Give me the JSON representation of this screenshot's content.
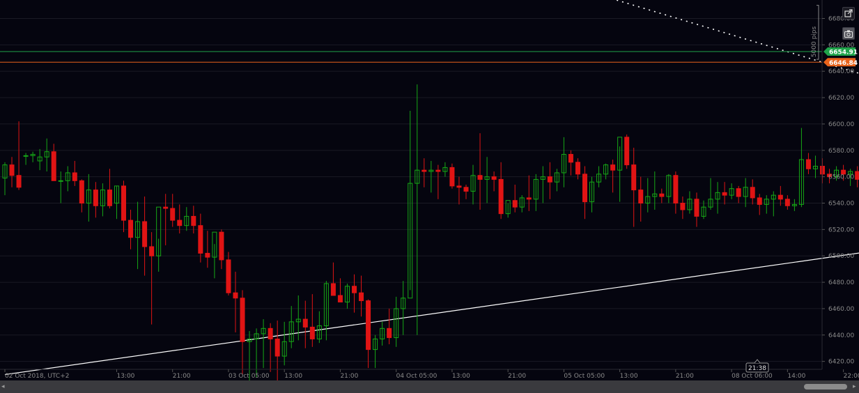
{
  "chart_data": {
    "type": "candlestick",
    "ylim": [
      6414,
      6694
    ],
    "y_ticks": [
      6420,
      6440,
      6460,
      6480,
      6500,
      6520,
      6540,
      6560,
      6580,
      6600,
      6620,
      6640,
      6660,
      6680
    ],
    "y_tick_labels": [
      "6420.00",
      "6440.00",
      "6460.00",
      "6480.00",
      "6500.00",
      "6520.00",
      "6540.00",
      "6560.00",
      "6580.00",
      "6600.00",
      "6620.00",
      "6640.00",
      "6660.00",
      "6680.00"
    ],
    "x_tick_labels": [
      {
        "label": "02 Oct 2018, UTC+2",
        "bar": 0
      },
      {
        "label": "13:00",
        "bar": 16
      },
      {
        "label": "21:00",
        "bar": 24
      },
      {
        "label": "03 Oct 05:00",
        "bar": 32
      },
      {
        "label": "13:00",
        "bar": 40
      },
      {
        "label": "21:00",
        "bar": 48
      },
      {
        "label": "04 Oct 05:00",
        "bar": 56
      },
      {
        "label": "13:00",
        "bar": 64
      },
      {
        "label": "21:00",
        "bar": 72
      },
      {
        "label": "05 Oct 05:00",
        "bar": 80
      },
      {
        "label": "13:00",
        "bar": 88
      },
      {
        "label": "21:00",
        "bar": 96
      },
      {
        "label": "08 Oct 06:00",
        "bar": 104
      },
      {
        "label": "14:00",
        "bar": 112
      },
      {
        "label": "22:00",
        "bar": 120
      }
    ],
    "candles": [
      [
        6559,
        6571,
        6546,
        6569
      ],
      [
        6569,
        6575,
        6552,
        6561
      ],
      [
        6561,
        6602,
        6550,
        6552
      ],
      [
        6576,
        6578,
        6569,
        6576
      ],
      [
        6576,
        6579,
        6571,
        6577
      ],
      [
        6572,
        6581,
        6565,
        6575
      ],
      [
        6575,
        6589,
        6564,
        6579
      ],
      [
        6579,
        6585,
        6560,
        6557
      ],
      [
        6557,
        6564,
        6540,
        6557
      ],
      [
        6557,
        6568,
        6549,
        6563
      ],
      [
        6563,
        6572,
        6553,
        6557
      ],
      [
        6557,
        6558,
        6533,
        6540
      ],
      [
        6540,
        6562,
        6526,
        6550
      ],
      [
        6550,
        6556,
        6529,
        6538
      ],
      [
        6538,
        6555,
        6530,
        6550
      ],
      [
        6550,
        6566,
        6536,
        6538
      ],
      [
        6540,
        6553,
        6528,
        6553
      ],
      [
        6553,
        6557,
        6518,
        6527
      ],
      [
        6527,
        6535,
        6505,
        6514
      ],
      [
        6514,
        6541,
        6490,
        6526
      ],
      [
        6526,
        6545,
        6485,
        6507
      ],
      [
        6507,
        6518,
        6448,
        6500
      ],
      [
        6500,
        6513,
        6488,
        6537
      ],
      [
        6537,
        6547,
        6508,
        6536
      ],
      [
        6536,
        6547,
        6522,
        6527
      ],
      [
        6527,
        6539,
        6517,
        6523
      ],
      [
        6523,
        6537,
        6519,
        6530
      ],
      [
        6530,
        6538,
        6517,
        6523
      ],
      [
        6523,
        6532,
        6495,
        6502
      ],
      [
        6502,
        6519,
        6491,
        6499
      ],
      [
        6499,
        6509,
        6483,
        6518
      ],
      [
        6518,
        6520,
        6490,
        6497
      ],
      [
        6497,
        6503,
        6470,
        6472
      ],
      [
        6472,
        6488,
        6442,
        6468
      ],
      [
        6468,
        6474,
        6410,
        6435
      ],
      [
        6435,
        6443,
        6405,
        6437
      ],
      [
        6437,
        6445,
        6408,
        6441
      ],
      [
        6441,
        6452,
        6415,
        6445
      ],
      [
        6445,
        6449,
        6412,
        6437
      ],
      [
        6437,
        6451,
        6405,
        6424
      ],
      [
        6424,
        6450,
        6417,
        6435
      ],
      [
        6435,
        6462,
        6430,
        6450
      ],
      [
        6450,
        6470,
        6436,
        6452
      ],
      [
        6452,
        6466,
        6430,
        6446
      ],
      [
        6446,
        6471,
        6431,
        6437
      ],
      [
        6437,
        6458,
        6434,
        6447
      ],
      [
        6447,
        6481,
        6436,
        6479
      ],
      [
        6479,
        6495,
        6477,
        6470
      ],
      [
        6470,
        6483,
        6465,
        6465
      ],
      [
        6465,
        6479,
        6460,
        6477
      ],
      [
        6477,
        6486,
        6457,
        6472
      ],
      [
        6472,
        6485,
        6454,
        6466
      ],
      [
        6466,
        6467,
        6415,
        6429
      ],
      [
        6429,
        6440,
        6415,
        6437
      ],
      [
        6437,
        6450,
        6432,
        6445
      ],
      [
        6445,
        6460,
        6433,
        6438
      ],
      [
        6438,
        6469,
        6431,
        6460
      ],
      [
        6460,
        6481,
        6440,
        6468
      ],
      [
        6468,
        6610,
        6474,
        6555
      ],
      [
        6555,
        6630,
        6440,
        6565
      ],
      [
        6565,
        6574,
        6552,
        6564
      ],
      [
        6564,
        6572,
        6548,
        6565
      ],
      [
        6565,
        6569,
        6543,
        6564
      ],
      [
        6564,
        6571,
        6560,
        6567
      ],
      [
        6567,
        6570,
        6551,
        6553
      ],
      [
        6553,
        6560,
        6539,
        6552
      ],
      [
        6552,
        6554,
        6543,
        6549
      ],
      [
        6549,
        6569,
        6539,
        6561
      ],
      [
        6561,
        6593,
        6535,
        6558
      ],
      [
        6558,
        6575,
        6540,
        6560
      ],
      [
        6560,
        6564,
        6549,
        6558
      ],
      [
        6558,
        6571,
        6528,
        6532
      ],
      [
        6532,
        6540,
        6529,
        6542
      ],
      [
        6542,
        6554,
        6533,
        6537
      ],
      [
        6537,
        6546,
        6533,
        6544
      ],
      [
        6544,
        6561,
        6534,
        6543
      ],
      [
        6543,
        6562,
        6534,
        6558
      ],
      [
        6558,
        6568,
        6540,
        6560
      ],
      [
        6560,
        6571,
        6543,
        6556
      ],
      [
        6556,
        6566,
        6549,
        6563
      ],
      [
        6563,
        6590,
        6552,
        6577
      ],
      [
        6577,
        6580,
        6561,
        6571
      ],
      [
        6571,
        6574,
        6558,
        6562
      ],
      [
        6562,
        6568,
        6528,
        6541
      ],
      [
        6541,
        6560,
        6533,
        6556
      ],
      [
        6556,
        6568,
        6552,
        6562
      ],
      [
        6562,
        6570,
        6558,
        6569
      ],
      [
        6569,
        6573,
        6548,
        6565
      ],
      [
        6565,
        6583,
        6541,
        6590
      ],
      [
        6590,
        6592,
        6566,
        6569
      ],
      [
        6569,
        6582,
        6522,
        6550
      ],
      [
        6550,
        6560,
        6526,
        6540
      ],
      [
        6540,
        6559,
        6533,
        6545
      ],
      [
        6545,
        6564,
        6535,
        6547
      ],
      [
        6547,
        6551,
        6540,
        6545
      ],
      [
        6545,
        6562,
        6540,
        6561
      ],
      [
        6561,
        6564,
        6532,
        6540
      ],
      [
        6540,
        6545,
        6528,
        6535
      ],
      [
        6535,
        6549,
        6532,
        6543
      ],
      [
        6543,
        6548,
        6522,
        6530
      ],
      [
        6530,
        6542,
        6528,
        6537
      ],
      [
        6537,
        6559,
        6535,
        6543
      ],
      [
        6543,
        6556,
        6532,
        6548
      ],
      [
        6548,
        6556,
        6539,
        6546
      ],
      [
        6546,
        6555,
        6543,
        6551
      ],
      [
        6551,
        6553,
        6540,
        6545
      ],
      [
        6545,
        6559,
        6537,
        6552
      ],
      [
        6552,
        6558,
        6539,
        6544
      ],
      [
        6544,
        6547,
        6531,
        6539
      ],
      [
        6539,
        6546,
        6532,
        6543
      ],
      [
        6543,
        6549,
        6530,
        6546
      ],
      [
        6546,
        6553,
        6538,
        6543
      ],
      [
        6543,
        6546,
        6535,
        6538
      ],
      [
        6538,
        6543,
        6534,
        6539
      ],
      [
        6539,
        6597,
        6537,
        6573
      ],
      [
        6573,
        6578,
        6562,
        6566
      ],
      [
        6566,
        6576,
        6559,
        6568
      ],
      [
        6568,
        6574,
        6555,
        6562
      ],
      [
        6562,
        6566,
        6555,
        6560
      ],
      [
        6560,
        6568,
        6557,
        6565
      ],
      [
        6565,
        6569,
        6557,
        6562
      ],
      [
        6562,
        6566,
        6553,
        6564
      ],
      [
        6564,
        6568,
        6552,
        6558
      ]
    ],
    "trendlines": [
      {
        "style": "solid",
        "color": "#ffffff",
        "points": [
          [
            0,
            6410
          ],
          [
            130,
            6508
          ]
        ]
      },
      {
        "style": "dotted",
        "color": "#ffffff",
        "points": [
          [
            70,
            6722
          ],
          [
            130,
            6626
          ]
        ]
      }
    ],
    "price_lines": [
      {
        "value": 6654.91,
        "label": "6654.91",
        "color": "#1fa34a"
      },
      {
        "value": 6646.84,
        "label": "6646.84",
        "color": "#e8621a"
      }
    ],
    "measure_label": "5000 pips",
    "crosshair_time": "21:38",
    "colors": {
      "bull": "#16a816",
      "bear": "#e01414",
      "background": "#05050f",
      "grid": "#1a1a24"
    }
  },
  "toolbar": {
    "popout_icon": "external-link-icon",
    "screenshot_icon": "camera-icon"
  },
  "scrollbar": {
    "left_arrow": "◂",
    "right_arrow": "▸"
  }
}
